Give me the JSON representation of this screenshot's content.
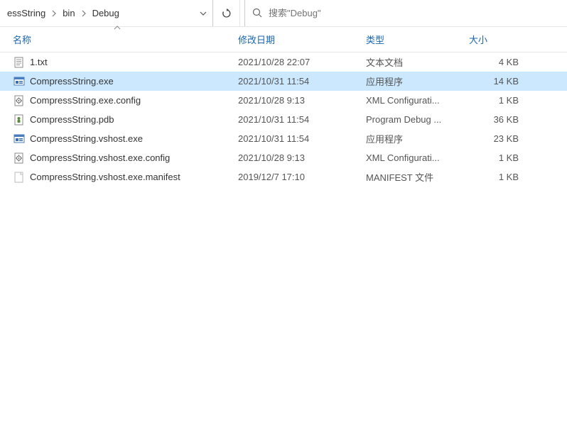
{
  "breadcrumb": {
    "items": [
      "essString",
      "bin",
      "Debug"
    ]
  },
  "search": {
    "placeholder": "搜索\"Debug\""
  },
  "columns": {
    "name": "名称",
    "date": "修改日期",
    "type": "类型",
    "size": "大小"
  },
  "files": [
    {
      "icon": "text",
      "name": "1.txt",
      "date": "2021/10/28 22:07",
      "type": "文本文档",
      "size": "4 KB",
      "selected": false
    },
    {
      "icon": "exe",
      "name": "CompressString.exe",
      "date": "2021/10/31 11:54",
      "type": "应用程序",
      "size": "14 KB",
      "selected": true
    },
    {
      "icon": "config",
      "name": "CompressString.exe.config",
      "date": "2021/10/28 9:13",
      "type": "XML Configurati...",
      "size": "1 KB",
      "selected": false
    },
    {
      "icon": "pdb",
      "name": "CompressString.pdb",
      "date": "2021/10/31 11:54",
      "type": "Program Debug ...",
      "size": "36 KB",
      "selected": false
    },
    {
      "icon": "exe",
      "name": "CompressString.vshost.exe",
      "date": "2021/10/31 11:54",
      "type": "应用程序",
      "size": "23 KB",
      "selected": false
    },
    {
      "icon": "config",
      "name": "CompressString.vshost.exe.config",
      "date": "2021/10/28 9:13",
      "type": "XML Configurati...",
      "size": "1 KB",
      "selected": false
    },
    {
      "icon": "blank",
      "name": "CompressString.vshost.exe.manifest",
      "date": "2019/12/7 17:10",
      "type": "MANIFEST 文件",
      "size": "1 KB",
      "selected": false
    }
  ]
}
